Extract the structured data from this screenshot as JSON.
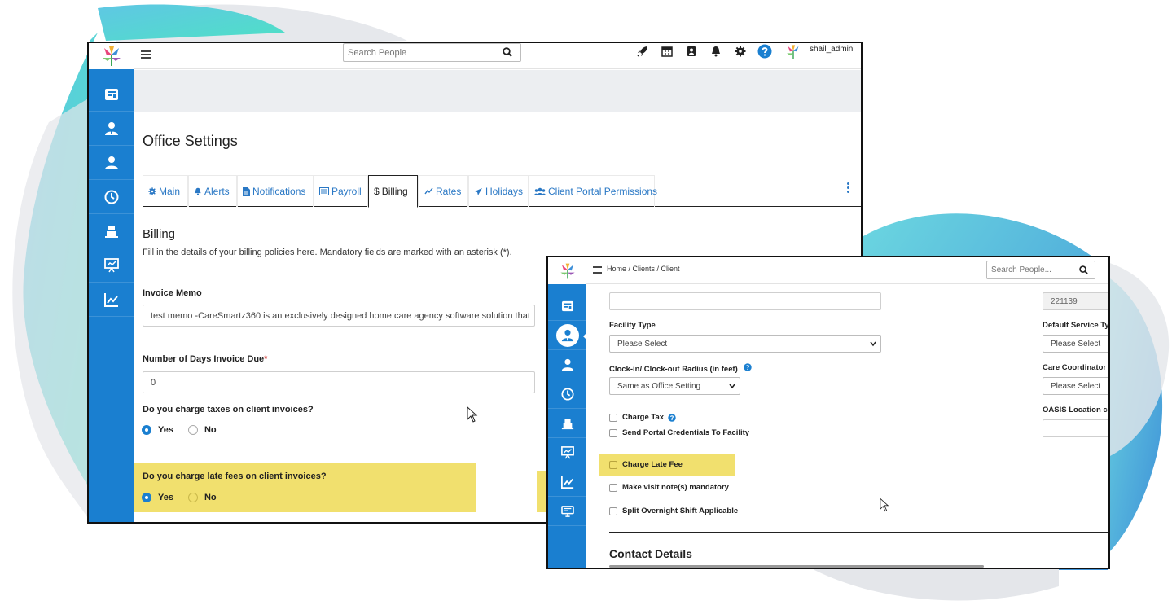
{
  "colors": {
    "sidebar_blue": "#1a7fd0",
    "link_blue": "#2a78c5",
    "highlight_yellow": "#f1e06e",
    "required_red": "#d9534f"
  },
  "window1": {
    "search": {
      "placeholder": "Search People",
      "icon": "search-icon"
    },
    "top_icons": [
      "rocket-icon",
      "calendar-icon",
      "contact-book-icon",
      "bell-icon",
      "gear-icon",
      "help-icon"
    ],
    "user": {
      "name": "shail_admin"
    },
    "sidebar_icons": [
      "dashboard-icon",
      "caregiver-icon",
      "client-icon",
      "clock-icon",
      "billing-icon",
      "presentation-icon",
      "chart-icon"
    ],
    "page_title": "Office Settings",
    "tabs": [
      {
        "label": "Main",
        "icon": "gear-icon"
      },
      {
        "label": "Alerts",
        "icon": "bell-icon"
      },
      {
        "label": "Notifications",
        "icon": "document-icon"
      },
      {
        "label": "Payroll",
        "icon": "list-icon"
      },
      {
        "label": "Billing",
        "icon": "dollar-icon",
        "active": true
      },
      {
        "label": "Rates",
        "icon": "line-chart-icon"
      },
      {
        "label": "Holidays",
        "icon": "plane-icon"
      },
      {
        "label": "Client Portal Permissions",
        "icon": "users-icon"
      }
    ],
    "billing": {
      "title": "Billing",
      "description": "Fill in the details of your billing policies here. Mandatory fields are marked with an asterisk (*).",
      "invoice_memo_label": "Invoice Memo",
      "invoice_memo_value": "test memo -CareSmartz360 is an exclusively designed home care agency software solution that",
      "days_due_label": "Number of Days Invoice Due",
      "days_due_required": "*",
      "days_due_value": "0",
      "taxes_question": "Do you charge taxes on client invoices?",
      "taxes_yes": "Yes",
      "taxes_no": "No",
      "taxes_selected": "Yes",
      "late_fee_question": "Do you charge late fees on client invoices?",
      "late_fee_yes": "Yes",
      "late_fee_no": "No",
      "late_fee_selected": "Yes"
    }
  },
  "window2": {
    "breadcrumb": "Home / Clients / Client",
    "search": {
      "placeholder": "Search People...",
      "icon": "search-icon"
    },
    "sidebar_icons": [
      "dashboard-icon",
      "caregiver-icon",
      "client-icon",
      "clock-icon",
      "billing-icon",
      "presentation-icon",
      "chart-icon",
      "monitor-icon"
    ],
    "form": {
      "top_input_value": "",
      "id_value": "221139",
      "facility_type_label": "Facility Type",
      "facility_type_value": "Please Select",
      "default_service_label": "Default Service Typ",
      "default_service_value": "Please Select",
      "clock_radius_label": "Clock-in/ Clock-out Radius (in feet)",
      "clock_radius_value": "Same as Office Setting",
      "care_coordinator_label": "Care Coordinator",
      "care_coordinator_value": "Please Select",
      "charge_tax_label": "Charge Tax",
      "portal_credentials_label": "Send Portal Credentials To Facility",
      "oasis_label": "OASIS Location cod",
      "oasis_value": "",
      "charge_late_fee_label": "Charge Late Fee",
      "visit_notes_label": "Make visit note(s) mandatory",
      "split_shift_label": "Split Overnight Shift Applicable",
      "contact_title": "Contact Details"
    }
  }
}
